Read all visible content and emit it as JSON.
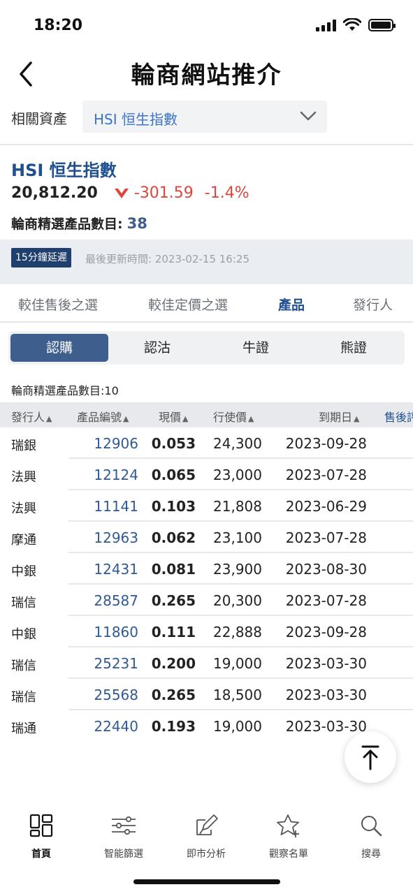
{
  "status_bar": {
    "time": "18:20"
  },
  "header": {
    "title": "輪商網站推介"
  },
  "asset_selector": {
    "label": "相關資產",
    "value": "HSI 恒生指數"
  },
  "asset": {
    "name": "HSI 恒生指數",
    "price": "20,812.20",
    "change": "-301.59",
    "change_pct": "-1.4%",
    "count_label": "輪商精選產品數目:",
    "count_value": "38"
  },
  "delay": {
    "badge": "15分鐘延遲",
    "updated": "最後更新時間: 2023-02-15 16:25"
  },
  "main_tabs": [
    {
      "label": "較佳售後之選"
    },
    {
      "label": "較佳定價之選"
    },
    {
      "label": "產品",
      "active": true
    },
    {
      "label": "發行人"
    }
  ],
  "sub_tabs": [
    {
      "label": "認購",
      "active": true
    },
    {
      "label": "認沽"
    },
    {
      "label": "牛證"
    },
    {
      "label": "熊證"
    }
  ],
  "list": {
    "count_label": "輪商精選產品數目:10",
    "columns": [
      "發行人",
      "產品編號",
      "現價",
      "行使價",
      "到期日",
      "售後評"
    ],
    "rows": [
      {
        "issuer": "瑞銀",
        "code": "12906",
        "price": "0.053",
        "strike": "24,300",
        "expiry": "2023-09-28"
      },
      {
        "issuer": "法興",
        "code": "12124",
        "price": "0.065",
        "strike": "23,000",
        "expiry": "2023-07-28"
      },
      {
        "issuer": "法興",
        "code": "11141",
        "price": "0.103",
        "strike": "21,808",
        "expiry": "2023-06-29"
      },
      {
        "issuer": "摩通",
        "code": "12963",
        "price": "0.062",
        "strike": "23,100",
        "expiry": "2023-07-28"
      },
      {
        "issuer": "中銀",
        "code": "12431",
        "price": "0.081",
        "strike": "23,900",
        "expiry": "2023-08-30"
      },
      {
        "issuer": "瑞信",
        "code": "28587",
        "price": "0.265",
        "strike": "20,300",
        "expiry": "2023-07-28"
      },
      {
        "issuer": "中銀",
        "code": "11860",
        "price": "0.111",
        "strike": "22,888",
        "expiry": "2023-09-28"
      },
      {
        "issuer": "瑞信",
        "code": "25231",
        "price": "0.200",
        "strike": "19,000",
        "expiry": "2023-03-30"
      },
      {
        "issuer": "瑞信",
        "code": "25568",
        "price": "0.265",
        "strike": "18,500",
        "expiry": "2023-03-30"
      },
      {
        "issuer": "瑞通",
        "code": "22440",
        "price": "0.193",
        "strike": "19,000",
        "expiry": "2023-03-30"
      }
    ]
  },
  "bottom_nav": [
    {
      "label": "首頁",
      "icon": "home-grid-icon",
      "active": true
    },
    {
      "label": "智能篩選",
      "icon": "filter-sliders-icon"
    },
    {
      "label": "即市分析",
      "icon": "analysis-pen-icon"
    },
    {
      "label": "觀察名單",
      "icon": "star-add-icon"
    },
    {
      "label": "搜尋",
      "icon": "search-icon"
    }
  ],
  "colors": {
    "brand": "#1f4f8f",
    "down": "#e0453a",
    "active_subtab": "#3e5f8e"
  }
}
